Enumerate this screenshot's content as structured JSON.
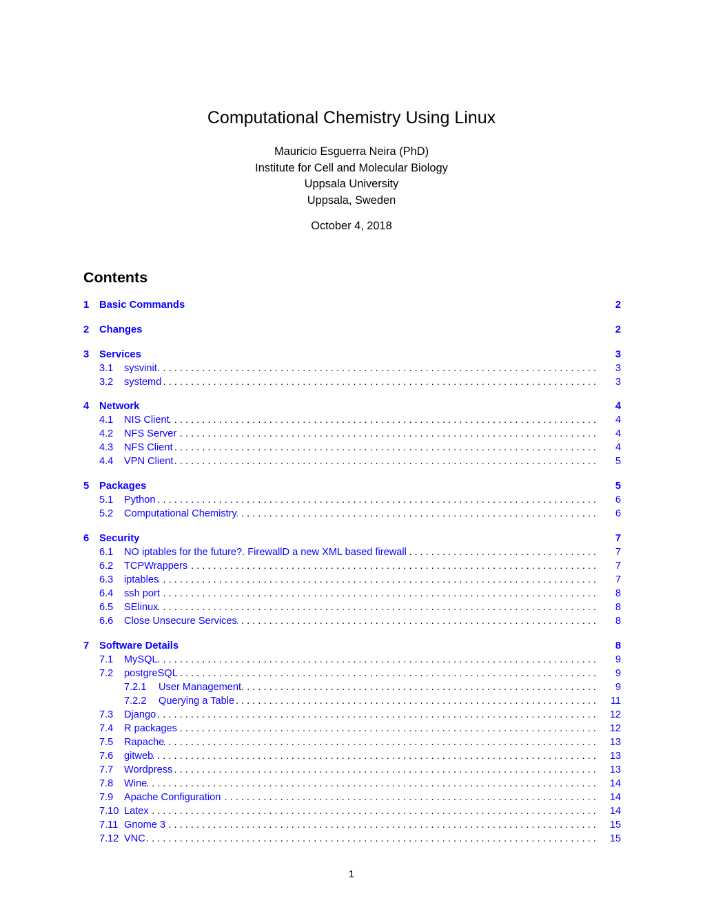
{
  "document": {
    "title": "Computational Chemistry Using Linux",
    "authors": [
      "Mauricio Esguerra Neira (PhD)",
      "Institute for Cell and Molecular Biology",
      "Uppsala University",
      "Uppsala, Sweden"
    ],
    "date": "October 4, 2018",
    "contents_heading": "Contents",
    "page_number": "1",
    "link_color": "#0a00ff"
  },
  "toc": [
    {
      "num": "1",
      "label": "Basic Commands",
      "page": "2",
      "children": []
    },
    {
      "num": "2",
      "label": "Changes",
      "page": "2",
      "children": []
    },
    {
      "num": "3",
      "label": "Services",
      "page": "3",
      "children": [
        {
          "num": "3.1",
          "label": "sysvinit",
          "page": "3"
        },
        {
          "num": "3.2",
          "label": "systemd",
          "page": "3"
        }
      ]
    },
    {
      "num": "4",
      "label": "Network",
      "page": "4",
      "children": [
        {
          "num": "4.1",
          "label": "NIS Client",
          "page": "4"
        },
        {
          "num": "4.2",
          "label": "NFS Server",
          "page": "4"
        },
        {
          "num": "4.3",
          "label": "NFS Client",
          "page": "4"
        },
        {
          "num": "4.4",
          "label": "VPN Client",
          "page": "5"
        }
      ]
    },
    {
      "num": "5",
      "label": "Packages",
      "page": "5",
      "children": [
        {
          "num": "5.1",
          "label": "Python",
          "page": "6"
        },
        {
          "num": "5.2",
          "label": "Computational Chemistry",
          "page": "6"
        }
      ]
    },
    {
      "num": "6",
      "label": "Security",
      "page": "7",
      "children": [
        {
          "num": "6.1",
          "label": "NO iptables for the future?. FirewallD a new XML based firewall",
          "page": "7"
        },
        {
          "num": "6.2",
          "label": "TCPWrappers",
          "page": "7"
        },
        {
          "num": "6.3",
          "label": "iptables",
          "page": "7"
        },
        {
          "num": "6.4",
          "label": "ssh port",
          "page": "8"
        },
        {
          "num": "6.5",
          "label": "SElinux",
          "page": "8"
        },
        {
          "num": "6.6",
          "label": "Close Unsecure Services",
          "page": "8"
        }
      ]
    },
    {
      "num": "7",
      "label": "Software Details",
      "page": "8",
      "children": [
        {
          "num": "7.1",
          "label": "MySQL",
          "page": "9"
        },
        {
          "num": "7.2",
          "label": "postgreSQL",
          "page": "9"
        },
        {
          "num": "7.2.1",
          "label": "User Management",
          "page": "9",
          "level": 3
        },
        {
          "num": "7.2.2",
          "label": "Querying a Table",
          "page": "11",
          "level": 3
        },
        {
          "num": "7.3",
          "label": "Django",
          "page": "12"
        },
        {
          "num": "7.4",
          "label": "R packages",
          "page": "12"
        },
        {
          "num": "7.5",
          "label": "Rapache",
          "page": "13"
        },
        {
          "num": "7.6",
          "label": "gitweb",
          "page": "13"
        },
        {
          "num": "7.7",
          "label": "Wordpress",
          "page": "13"
        },
        {
          "num": "7.8",
          "label": "Wine",
          "page": "14"
        },
        {
          "num": "7.9",
          "label": "Apache Configuration",
          "page": "14"
        },
        {
          "num": "7.10",
          "label": "Latex",
          "page": "14"
        },
        {
          "num": "7.11",
          "label": "Gnome 3",
          "page": "15"
        },
        {
          "num": "7.12",
          "label": "VNC",
          "page": "15"
        }
      ]
    }
  ]
}
